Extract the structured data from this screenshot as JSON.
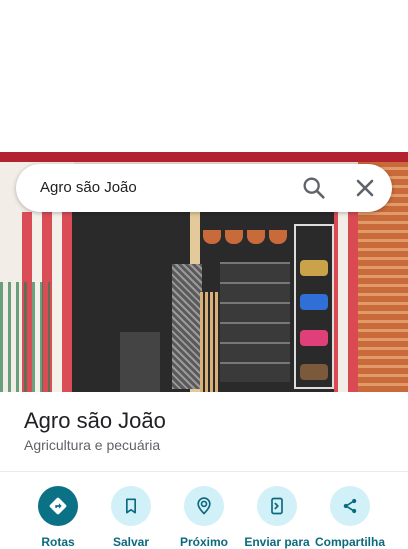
{
  "search": {
    "query": "Agro são João"
  },
  "place": {
    "name": "Agro são João",
    "category": "Agricultura e pecuária"
  },
  "actions": [
    {
      "label": "Rotas",
      "icon": "directions-icon"
    },
    {
      "label": "Salvar",
      "icon": "bookmark-icon"
    },
    {
      "label": "Próximo",
      "icon": "nearby-icon"
    },
    {
      "label": "Enviar para",
      "icon": "send-to-phone-icon"
    },
    {
      "label": "Compartilha",
      "icon": "share-icon"
    }
  ],
  "colors": {
    "accent": "#0b7285",
    "action_bg": "#d2f0f7",
    "label": "#0b6a7d"
  }
}
